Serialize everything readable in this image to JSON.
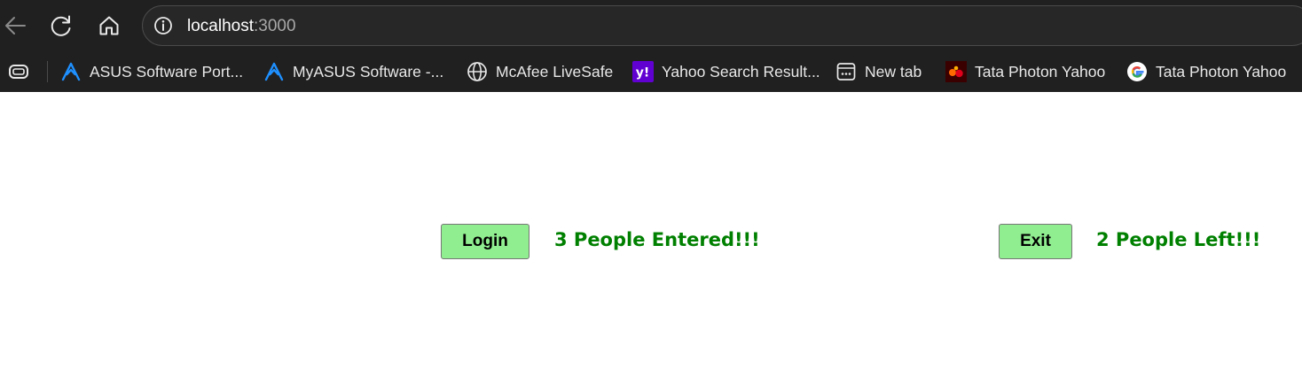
{
  "browser": {
    "url": {
      "host": "localhost",
      "port": ":3000"
    },
    "bookmarks": [
      {
        "label": "ASUS Software Port...",
        "icon": "asus-logo-icon"
      },
      {
        "label": "MyASUS Software -...",
        "icon": "asus-logo-icon"
      },
      {
        "label": "McAfee LiveSafe",
        "icon": "globe-icon"
      },
      {
        "label": "Yahoo Search Result...",
        "icon": "yahoo-icon"
      },
      {
        "label": "New tab",
        "icon": "new-tab-icon"
      },
      {
        "label": "Tata Photon Yahoo",
        "icon": "tata-photon-icon"
      },
      {
        "label": "Tata Photon Yahoo",
        "icon": "google-icon"
      }
    ]
  },
  "main": {
    "login_label": "Login",
    "entered_text": "3 People Entered!!!",
    "exit_label": "Exit",
    "left_text": "2 People Left!!!"
  },
  "colors": {
    "button_bg": "#90ee90",
    "status_text": "#008000",
    "chrome_bg": "#202020",
    "asus_blue": "#1e90ff",
    "yahoo_purple": "#6001d2"
  }
}
